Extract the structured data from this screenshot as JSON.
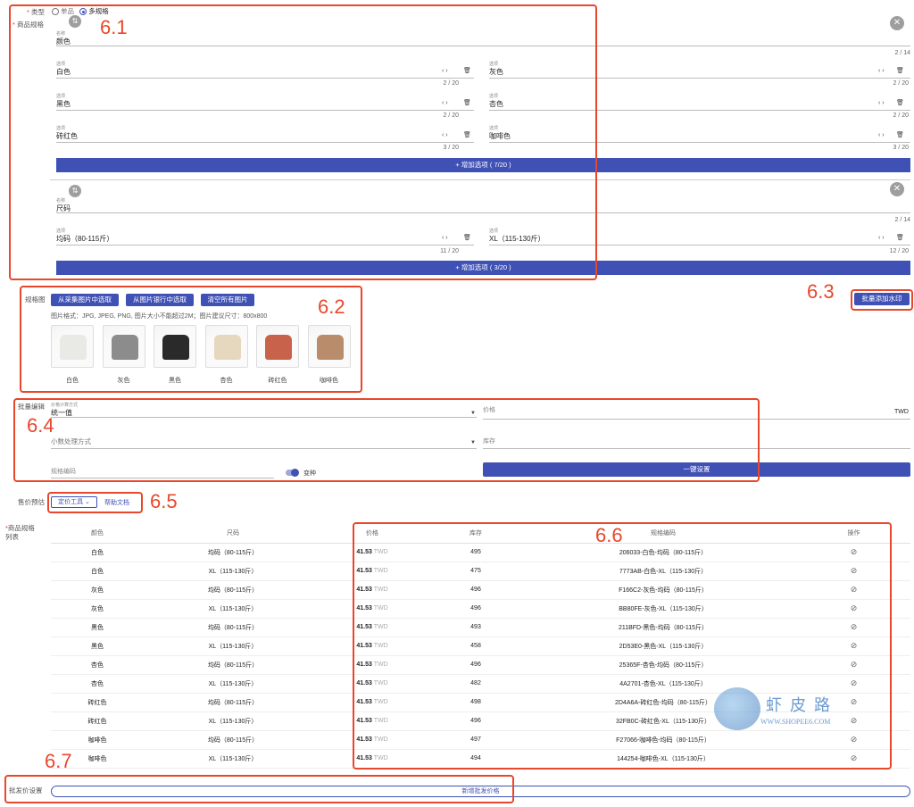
{
  "type_row": {
    "label": "类型",
    "option_single": "单品",
    "option_multi": "多规格"
  },
  "spec_label": "商品规格",
  "spec1": {
    "name_caption": "名称",
    "name_value": "颜色",
    "name_counter": "2 / 14",
    "options": [
      {
        "caption": "选项",
        "value": "白色",
        "counter": "2 / 20"
      },
      {
        "caption": "选项",
        "value": "灰色",
        "counter": "2 / 20"
      },
      {
        "caption": "选项",
        "value": "黑色",
        "counter": "2 / 20"
      },
      {
        "caption": "选项",
        "value": "杏色",
        "counter": "2 / 20"
      },
      {
        "caption": "选项",
        "value": "砖红色",
        "counter": "3 / 20"
      },
      {
        "caption": "选项",
        "value": "咖啡色",
        "counter": "3 / 20"
      }
    ],
    "add_option": "+ 增加选项 ( 7/20 )"
  },
  "spec2": {
    "name_caption": "名称",
    "name_value": "尺码",
    "name_counter": "2 / 14",
    "options": [
      {
        "caption": "选项",
        "value": "均码（80-115斤）",
        "counter": "11 / 20"
      },
      {
        "caption": "选项",
        "value": "XL（115-130斤）",
        "counter": "12 / 20"
      }
    ],
    "add_option": "+ 增加选项 ( 3/20 )"
  },
  "icons": {
    "close": "close-icon",
    "drag": "drag-icon",
    "arrows": "‹ ›",
    "delete": "delete-icon"
  },
  "spec_image": {
    "label": "规格图",
    "btn_collect": "从采集图片中选取",
    "btn_bank": "从图片银行中选取",
    "btn_clear": "清空所有图片",
    "hint": "图片格式：JPG, JPEG, PNG, 图片大小不能超过2M；图片建议尺寸：800x800",
    "thumbs": [
      {
        "label": "白色",
        "color": "#e9e9e6"
      },
      {
        "label": "灰色",
        "color": "#8c8c8c"
      },
      {
        "label": "黑色",
        "color": "#2a2a2a"
      },
      {
        "label": "杏色",
        "color": "#e6d8be"
      },
      {
        "label": "砖红色",
        "color": "#c9624a"
      },
      {
        "label": "咖啡色",
        "color": "#b98c6c"
      }
    ]
  },
  "watermark_btn": "批量添加水印",
  "batch": {
    "label": "批量编辑",
    "price_method_caption": "价格计算方式",
    "price_method_value": "统一值",
    "decimal_placeholder": "小数处理方式",
    "price_placeholder": "价格",
    "currency": "TWD",
    "stock_placeholder": "库存",
    "sku_code_placeholder": "规格编码",
    "toggle_label": "变种",
    "apply_btn": "一键设置"
  },
  "price_estimate": {
    "label": "售价预估",
    "tool_btn": "定价工具 ⌄",
    "help_btn": "帮助文档"
  },
  "sku_table": {
    "label": "商品规格列表",
    "headers": [
      "颜色",
      "尺码",
      "价格",
      "库存",
      "规格编码",
      "操作"
    ],
    "rows": [
      [
        "白色",
        "均码（80-115斤）",
        "41.53",
        "TWD",
        "495",
        "206033-白色-均码（80-115斤）"
      ],
      [
        "白色",
        "XL（115-130斤）",
        "41.53",
        "TWD",
        "475",
        "7773AB-白色-XL（115-130斤）"
      ],
      [
        "灰色",
        "均码（80-115斤）",
        "41.53",
        "TWD",
        "496",
        "F166C2-灰色-均码（80-115斤）"
      ],
      [
        "灰色",
        "XL（115-130斤）",
        "41.53",
        "TWD",
        "496",
        "BB80FE-灰色-XL（115-130斤）"
      ],
      [
        "黑色",
        "均码（80-115斤）",
        "41.53",
        "TWD",
        "493",
        "211BFD-黑色-均码（80-115斤）"
      ],
      [
        "黑色",
        "XL（115-130斤）",
        "41.53",
        "TWD",
        "458",
        "2D53E0-黑色-XL（115-130斤）"
      ],
      [
        "杏色",
        "均码（80-115斤）",
        "41.53",
        "TWD",
        "496",
        "25365F-杏色-均码（80-115斤）"
      ],
      [
        "杏色",
        "XL（115-130斤）",
        "41.53",
        "TWD",
        "482",
        "4A2701-杏色-XL（115-130斤）"
      ],
      [
        "砖红色",
        "均码（80-115斤）",
        "41.53",
        "TWD",
        "498",
        "2D4A6A-砖红色-均码（80-115斤）"
      ],
      [
        "砖红色",
        "XL（115-130斤）",
        "41.53",
        "TWD",
        "496",
        "32FB0C-砖红色-XL（115-130斤）"
      ],
      [
        "咖啡色",
        "均码（80-115斤）",
        "41.53",
        "TWD",
        "497",
        "F27066-咖啡色-均码（80-115斤）"
      ],
      [
        "咖啡色",
        "XL（115-130斤）",
        "41.53",
        "TWD",
        "494",
        "144254-咖啡色-XL（115-130斤）"
      ]
    ]
  },
  "wholesale": {
    "label": "批发价设置",
    "btn": "新增批发价格"
  },
  "watermark_logo": {
    "title": "虾 皮 路",
    "url": "WWW.SHOPEE6.COM"
  },
  "annotations": {
    "a61": "6.1",
    "a62": "6.2",
    "a63": "6.3",
    "a64": "6.4",
    "a65": "6.5",
    "a66": "6.6",
    "a67": "6.7"
  },
  "colors": {
    "accent": "#3f51b5",
    "annotation": "#e8472b"
  }
}
